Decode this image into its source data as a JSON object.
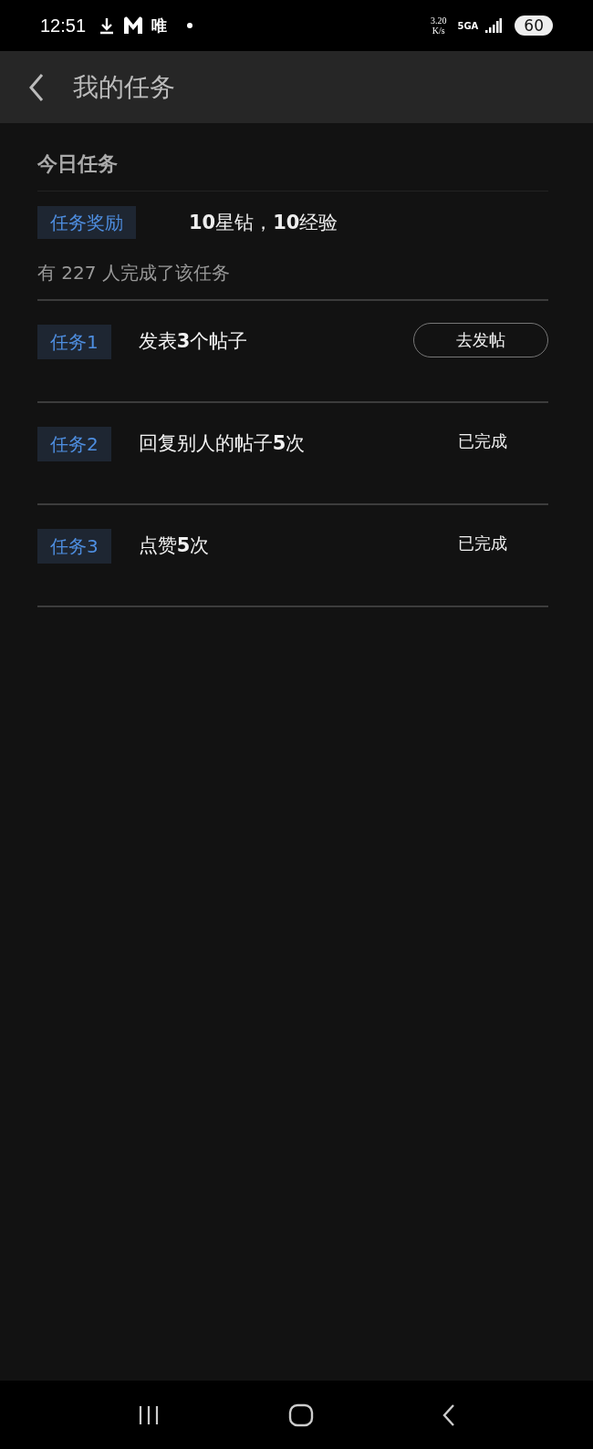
{
  "status_bar": {
    "time": "12:51",
    "app_label": "唯",
    "speed_value": "3.20",
    "speed_unit": "K/s",
    "network": "5GA",
    "battery": "60"
  },
  "header": {
    "title": "我的任务"
  },
  "section": {
    "title": "今日任务",
    "reward_tag": "任务奖励",
    "reward": "**10**星钻，**10**经验",
    "completed_count": "有 227 人完成了该任务"
  },
  "tasks": [
    {
      "tag": "任务1",
      "title": "发表**3**个帖子",
      "completed": false,
      "action": "去发帖"
    },
    {
      "tag": "任务2",
      "title": "回复别人的帖子**5**次",
      "completed": true,
      "status": "已完成"
    },
    {
      "tag": "任务3",
      "title": "点赞**5**次",
      "completed": true,
      "status": "已完成"
    }
  ]
}
